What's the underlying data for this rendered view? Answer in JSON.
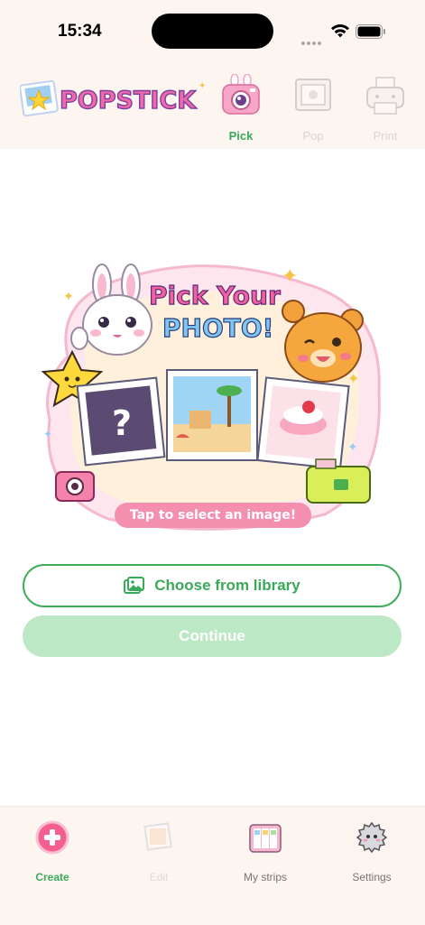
{
  "status_bar": {
    "time": "15:34"
  },
  "header": {
    "logo_text": "POPSTICK",
    "steps": [
      {
        "label": "Pick",
        "icon": "camera-icon",
        "state": "active"
      },
      {
        "label": "Pop",
        "icon": "frame-icon",
        "state": "inactive"
      },
      {
        "label": "Print",
        "icon": "printer-icon",
        "state": "inactive"
      }
    ]
  },
  "hero": {
    "title_line1": "Pick Your",
    "title_line2": "PHOTO!",
    "caption": "Tap to select an image!"
  },
  "actions": {
    "choose_label": "Choose from library",
    "choose_icon": "photo-library-icon",
    "continue_label": "Continue"
  },
  "tab_bar": {
    "tabs": [
      {
        "label": "Create",
        "icon": "plus-badge-icon",
        "state": "active"
      },
      {
        "label": "Edit",
        "icon": "edit-photos-icon",
        "state": "disabled"
      },
      {
        "label": "My strips",
        "icon": "photo-strips-icon",
        "state": "normal"
      },
      {
        "label": "Settings",
        "icon": "gear-cloud-icon",
        "state": "normal"
      }
    ]
  },
  "colors": {
    "accent_green": "#3aaa5a",
    "continue_disabled": "#bde8c6",
    "header_bg": "#fdf5f0",
    "caption_pink": "#f58fb0"
  }
}
